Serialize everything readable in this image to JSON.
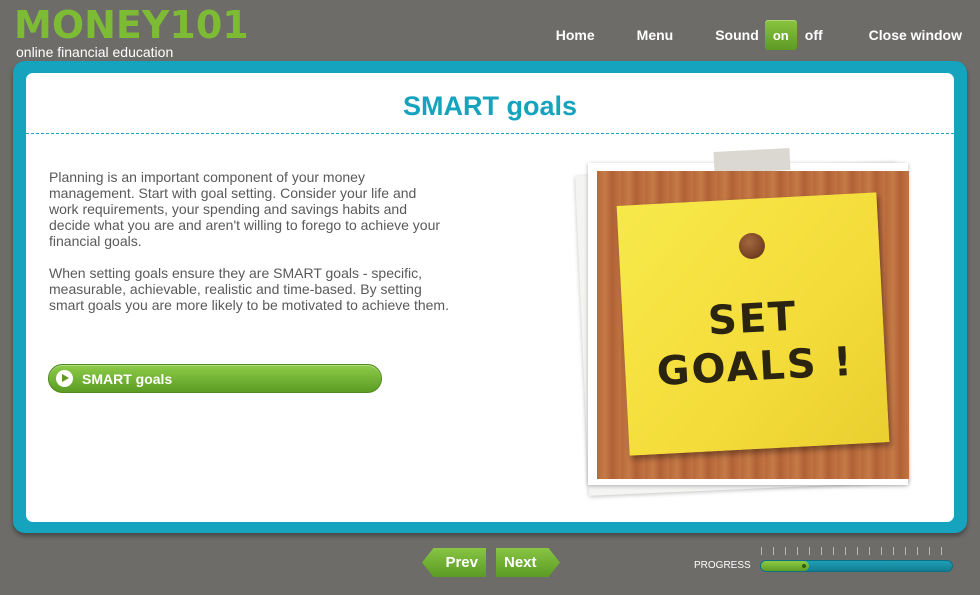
{
  "brand": {
    "name": "MONEY101",
    "tagline": "online financial education",
    "accent_color": "#7dbb35"
  },
  "nav": {
    "home": "Home",
    "menu": "Menu",
    "sound_label": "Sound",
    "sound_on": "on",
    "sound_off": "off",
    "close": "Close window"
  },
  "page": {
    "title": "SMART goals",
    "paragraphs": [
      "Planning is an important component of your money management. Start with goal setting. Consider your life and work requirements, your spending and savings habits and decide what you are and aren't willing to forego to achieve your financial goals.",
      "When setting goals ensure they are SMART goals - specific, measurable, achievable, realistic and time-based. By setting smart goals you are more likely to be motivated to achieve them."
    ],
    "button_label": "SMART goals",
    "photo_note_line1": "SET",
    "photo_note_line2": "GOALS !"
  },
  "footer": {
    "prev": "Prev",
    "next": "Next",
    "progress_label": "PROGRESS",
    "progress_fraction": 0.25
  },
  "colors": {
    "frame": "#16a3bd",
    "button_green": "#6aa82e",
    "background": "#6d6c69"
  }
}
